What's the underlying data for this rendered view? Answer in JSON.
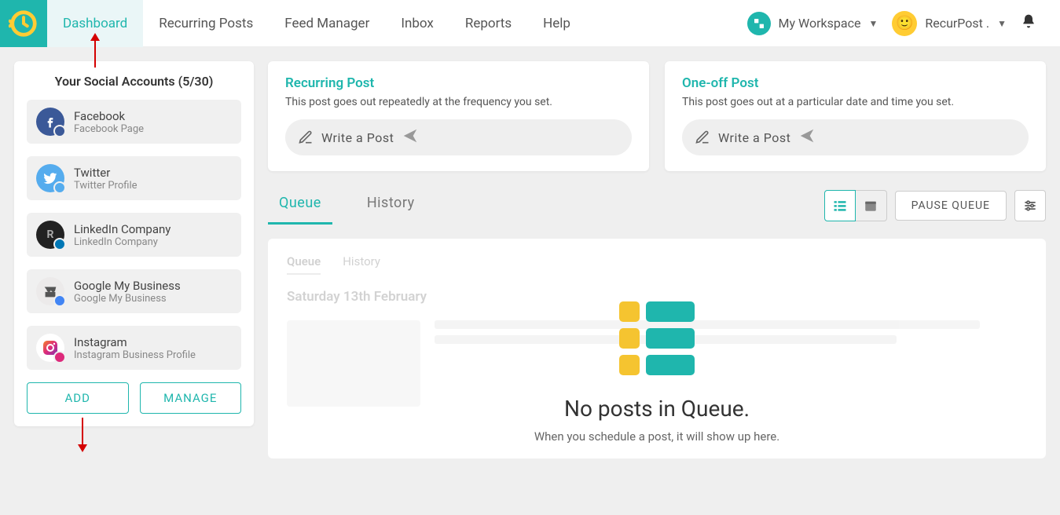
{
  "nav": {
    "items": [
      "Dashboard",
      "Recurring Posts",
      "Feed Manager",
      "Inbox",
      "Reports",
      "Help"
    ],
    "active": 0
  },
  "header": {
    "workspace_label": "My Workspace",
    "user_label": "RecurPost ."
  },
  "sidebar": {
    "title": "Your Social Accounts (5/30)",
    "accounts": [
      {
        "name": "Facebook",
        "sub": "Facebook Page"
      },
      {
        "name": "Twitter",
        "sub": "Twitter Profile"
      },
      {
        "name": "LinkedIn Company",
        "sub": "LinkedIn Company"
      },
      {
        "name": "Google My Business",
        "sub": "Google My Business"
      },
      {
        "name": "Instagram",
        "sub": "Instagram Business Profile"
      }
    ],
    "add_label": "ADD",
    "manage_label": "MANAGE"
  },
  "post_cards": {
    "recurring": {
      "title": "Recurring Post",
      "desc": "This post goes out repeatedly at the frequency you set.",
      "cta": "Write a Post"
    },
    "oneoff": {
      "title": "One-off Post",
      "desc": "This post goes out at a particular date and time you set.",
      "cta": "Write a Post"
    }
  },
  "queue": {
    "tabs": {
      "queue": "Queue",
      "history": "History"
    },
    "pause_label": "PAUSE QUEUE",
    "ghost": {
      "tabs": {
        "queue": "Queue",
        "history": "History"
      },
      "date": "Saturday 13th February"
    },
    "empty": {
      "title": "No posts in Queue.",
      "sub": "When you schedule a post, it will show up here."
    }
  }
}
